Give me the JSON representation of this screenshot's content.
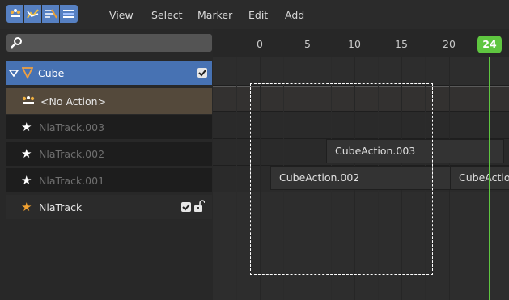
{
  "header": {
    "editor_buttons": [
      {
        "name": "nla-editor-icon",
        "active": true
      },
      {
        "name": "graph-editor-icon",
        "active": true
      },
      {
        "name": "drivers-icon",
        "active": true
      },
      {
        "name": "dopesheet-icon",
        "active": true
      }
    ],
    "menus": [
      "View",
      "Select",
      "Marker",
      "Edit",
      "Add"
    ]
  },
  "search": {
    "placeholder": "",
    "icon": "search-icon"
  },
  "channels": {
    "object": {
      "label": "Cube",
      "checked": true,
      "icon": "mesh-icon"
    },
    "action": {
      "label": "<No Action>",
      "icon": "action-icon"
    },
    "tracks": [
      {
        "label": "NlaTrack.003",
        "icon": "star-icon"
      },
      {
        "label": "NlaTrack.002",
        "icon": "star-icon"
      },
      {
        "label": "NlaTrack.001",
        "icon": "star-icon"
      }
    ],
    "active_track": {
      "label": "NlaTrack",
      "icon": "star-icon",
      "checked": true,
      "locked": false
    }
  },
  "ruler": {
    "ticks": [
      "0",
      "5",
      "10",
      "15",
      "20"
    ],
    "current_frame": "24"
  },
  "strips": [
    {
      "label": "CubeAction.003",
      "track": "NlaTrack.002"
    },
    {
      "label": "CubeAction.002",
      "track": "NlaTrack.001"
    },
    {
      "label": "CubeActio",
      "track": "NlaTrack.001"
    }
  ],
  "colors": {
    "accent": "#4772b3",
    "playhead": "#5fc640",
    "action_row": "#54493b",
    "star_active": "#f0a030"
  }
}
